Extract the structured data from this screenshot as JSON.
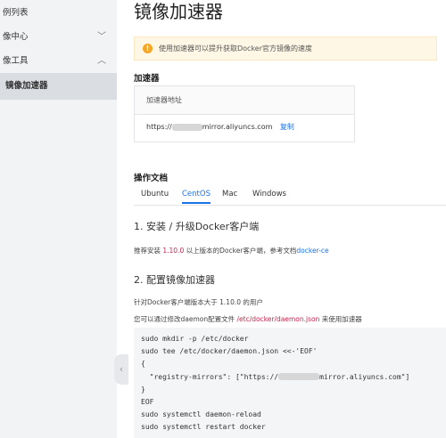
{
  "sidebar": {
    "items": [
      {
        "label": "例列表"
      },
      {
        "label": "像中心"
      },
      {
        "label": "像工具"
      },
      {
        "label": "镜像加速器"
      }
    ],
    "collapse_icon": "‹"
  },
  "main": {
    "title": "镜像加速器",
    "notice": "使用加速器可以提升获取Docker官方镜像的速度",
    "accelerator": {
      "heading": "加速器",
      "table_header": "加速器地址",
      "url_prefix": "https://",
      "url_suffix": "mirror.aliyuncs.com",
      "copy_label": "复制"
    },
    "docs": {
      "heading": "操作文档",
      "tabs": [
        "Ubuntu",
        "CentOS",
        "Mac",
        "Windows"
      ],
      "active_tab": "CentOS",
      "step1_title": "1. 安装 / 升级Docker客户端",
      "step1_text_a": "推荐安装",
      "step1_version": " 1.10.0 ",
      "step1_text_b": "以上版本的Docker客户端，参考文档",
      "step1_link": "docker-ce",
      "step2_title": "2. 配置镜像加速器",
      "step2_line1": "针对Docker客户端版本大于 1.10.0 的用户",
      "step2_line2_a": "您可以通过修改daemon配置文件",
      "step2_path": " /etc/docker/daemon.json ",
      "step2_line2_b": "来使用加速器",
      "code": [
        "sudo mkdir -p /etc/docker",
        "sudo tee /etc/docker/daemon.json <<-'EOF'",
        "{",
        "  \"registry-mirrors\": [\"https://",
        "}",
        "EOF",
        "sudo systemctl daemon-reload",
        "sudo systemctl restart docker"
      ],
      "code_mirror_suffix": "mirror.aliyuncs.com\"]"
    }
  }
}
